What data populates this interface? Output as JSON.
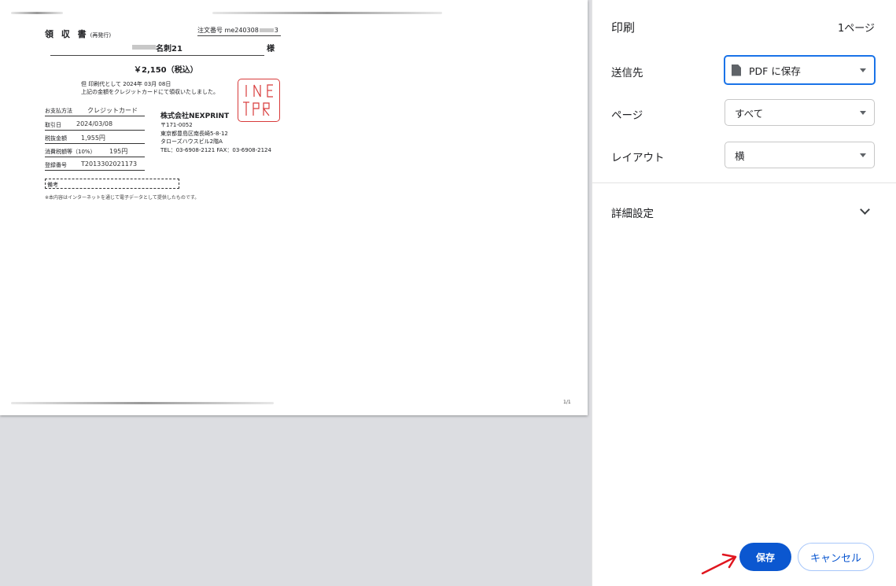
{
  "receipt": {
    "title": "領 収 書",
    "title_sub": "(再発行)",
    "order_label": "注文番号 me240308",
    "order_tail": "3",
    "customer_name": "名刺21",
    "honorific": "様",
    "amount": "￥2,150（税込）",
    "note_line1": "但 印刷代として 2024年 03月 08日",
    "note_line2": "上記の金額をクレジットカードにて領収いたしました。",
    "stamp_text": "NEXPRINT",
    "rows": [
      {
        "key": "お支払方法",
        "value": "クレジットカード"
      },
      {
        "key": "取引日",
        "value": "2024/03/08"
      },
      {
        "key": "税抜金額",
        "value": "1,955円"
      },
      {
        "key": "消費税額等（10%）",
        "value": "195円"
      },
      {
        "key": "登録番号",
        "value": "T2013302021173"
      }
    ],
    "company": "株式会社NEXPRINT",
    "postal": "〒171-0052",
    "address1": "東京都豊島区南長崎5-8-12",
    "address2": "タローズハウスビル2階A",
    "tel": "TEL：03-6908-2121  FAX：03-6908-2124",
    "memo_label": "備考",
    "footnote": "※本内容はインターネットを通じて電子データとして提供したものです。",
    "page_number": "1/1"
  },
  "panel": {
    "title": "印刷",
    "page_count": "1ページ",
    "destination_label": "送信先",
    "destination_value": "PDF に保存",
    "pages_label": "ページ",
    "pages_value": "すべて",
    "layout_label": "レイアウト",
    "layout_value": "横",
    "advanced_label": "詳細設定",
    "save_label": "保存",
    "cancel_label": "キャンセル"
  },
  "colors": {
    "accent": "#0b57d0",
    "focus": "#1a73e8",
    "stamp": "#d83b3b",
    "annotation_arrow": "#e0161f"
  },
  "icons": [
    "document-icon",
    "caret-down-icon",
    "chevron-down-icon",
    "red-arrow-annotation"
  ]
}
